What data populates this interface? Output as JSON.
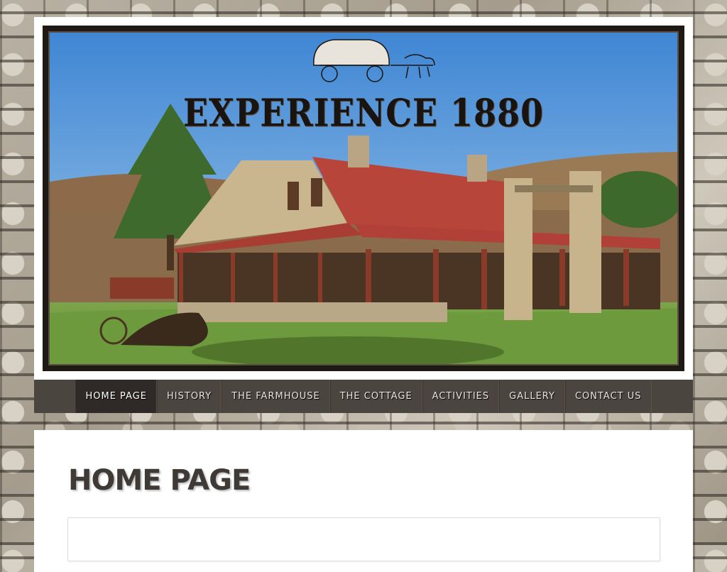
{
  "header": {
    "site_title": "EXPERIENCE 1880"
  },
  "nav": {
    "items": [
      {
        "label": "HOME PAGE",
        "active": true
      },
      {
        "label": "HISTORY",
        "active": false
      },
      {
        "label": "THE FARMHOUSE",
        "active": false
      },
      {
        "label": "THE COTTAGE",
        "active": false
      },
      {
        "label": "ACTIVITIES",
        "active": false
      },
      {
        "label": "GALLERY",
        "active": false
      },
      {
        "label": "CONTACT US",
        "active": false
      }
    ]
  },
  "main": {
    "page_title": "HOME PAGE"
  },
  "colors": {
    "nav_bg": "#4b4540",
    "nav_active": "#2f2a27",
    "roof": "#b8453a",
    "sky": "#4d8fd6"
  }
}
